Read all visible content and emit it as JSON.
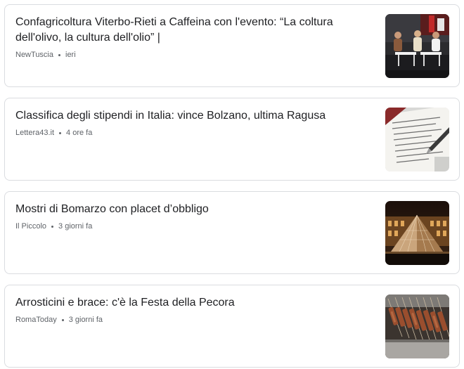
{
  "articles": [
    {
      "title": "Confagricoltura Viterbo-Rieti a Caffeina con l'evento: “La coltura dell'olivo, la cultura dell'olio” |",
      "source": "NewTuscia",
      "time": "ieri",
      "image": "conference-panel-photo"
    },
    {
      "title": "Classifica degli stipendi in Italia: vince Bolzano, ultima Ragusa",
      "source": "Lettera43.it",
      "time": "4 ore fa",
      "image": "document-and-pen-photo"
    },
    {
      "title": "Mostri di Bomarzo con placet d’obbligo",
      "source": "Il Piccolo",
      "time": "3 giorni fa",
      "image": "louvre-pyramid-night-photo"
    },
    {
      "title": "Arrosticini e brace: c'è la Festa della Pecora",
      "source": "RomaToday",
      "time": "3 giorni fa",
      "image": "arrosticini-grill-photo"
    }
  ]
}
